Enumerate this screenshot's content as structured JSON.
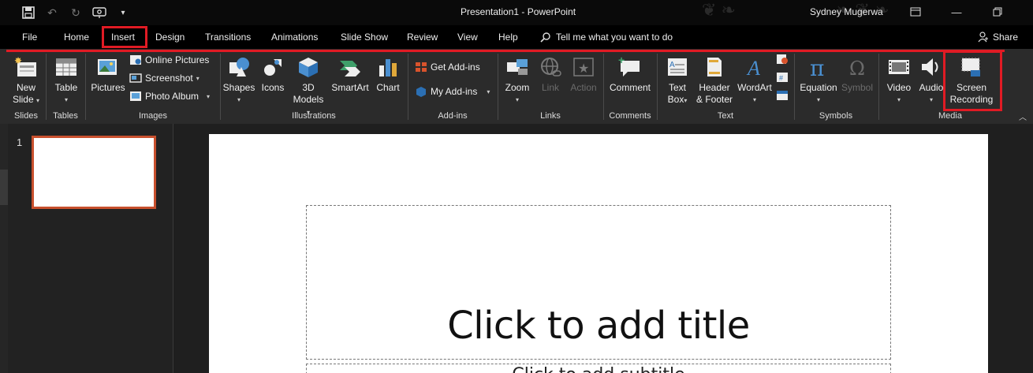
{
  "titlebar": {
    "title": "Presentation1  -  PowerPoint",
    "user": "Sydney Mugerwa",
    "qat_icons": [
      "save-icon",
      "undo-icon",
      "redo-icon",
      "touch-mode-icon",
      "customize-qat-icon"
    ],
    "window_buttons": [
      "ribbon-display-icon",
      "minimize-icon",
      "restore-icon",
      "close-icon"
    ]
  },
  "menu": {
    "tabs": [
      "File",
      "Home",
      "Insert",
      "Design",
      "Transitions",
      "Animations",
      "Slide Show",
      "Review",
      "View",
      "Help"
    ],
    "active_tab": "Insert",
    "tell_me": "Tell me what you want to do",
    "share": "Share"
  },
  "ribbon": {
    "groups": {
      "slides": "Slides",
      "tables": "Tables",
      "images": "Images",
      "illustrations": "Illustrations",
      "addins": "Add-ins",
      "links": "Links",
      "comments": "Comments",
      "text": "Text",
      "symbols": "Symbols",
      "media": "Media"
    },
    "buttons": {
      "new_slide_1": "New",
      "new_slide_2": "Slide",
      "table": "Table",
      "pictures": "Pictures",
      "online_pictures": "Online Pictures",
      "screenshot": "Screenshot",
      "photo_album": "Photo Album",
      "shapes": "Shapes",
      "icons": "Icons",
      "models_1": "3D",
      "models_2": "Models",
      "smartart": "SmartArt",
      "chart": "Chart",
      "get_addins": "Get Add-ins",
      "my_addins": "My Add-ins",
      "zoom": "Zoom",
      "link": "Link",
      "action": "Action",
      "comment": "Comment",
      "textbox_1": "Text",
      "textbox_2": "Box",
      "header_1": "Header",
      "header_2": "& Footer",
      "wordart": "WordArt",
      "equation": "Equation",
      "symbol": "Symbol",
      "video": "Video",
      "audio": "Audio",
      "screenrec_1": "Screen",
      "screenrec_2": "Recording"
    },
    "accent_color": "#e01b24"
  },
  "slides_pane": {
    "slide_number": "1"
  },
  "slide": {
    "title_placeholder": "Click to add title",
    "subtitle_placeholder": "Click to add subtitle"
  }
}
